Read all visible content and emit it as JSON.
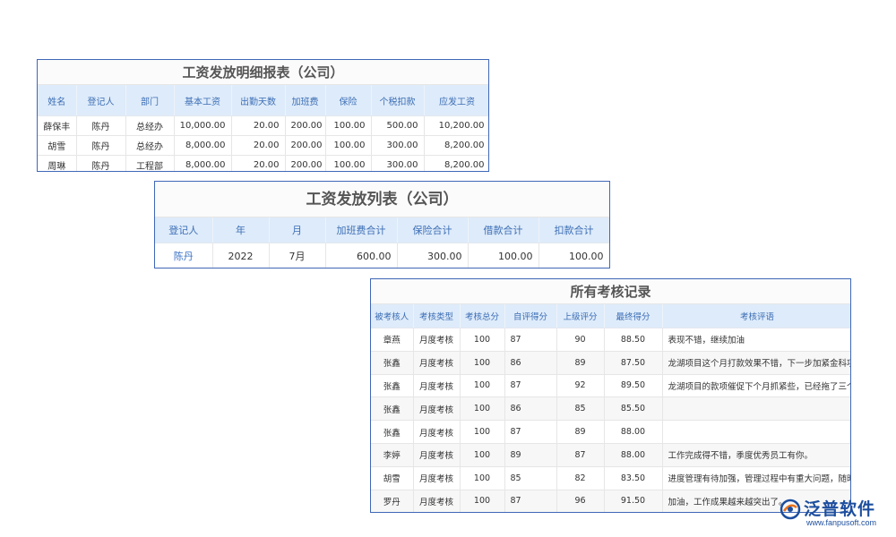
{
  "salary_detail": {
    "title": "工资发放明细报表（公司）",
    "columns": [
      "姓名",
      "登记人",
      "部门",
      "基本工资",
      "出勤天数",
      "加班费",
      "保险",
      "个税扣款",
      "应发工资"
    ],
    "rows": [
      [
        "薛保丰",
        "陈丹",
        "总经办",
        "10,000.00",
        "20.00",
        "200.00",
        "100.00",
        "500.00",
        "10,200.00"
      ],
      [
        "胡雪",
        "陈丹",
        "总经办",
        "8,000.00",
        "20.00",
        "200.00",
        "100.00",
        "300.00",
        "8,200.00"
      ],
      [
        "周琳",
        "陈丹",
        "工程部",
        "8,000.00",
        "20.00",
        "200.00",
        "100.00",
        "300.00",
        "8,200.00"
      ]
    ]
  },
  "salary_list": {
    "title": "工资发放列表（公司）",
    "columns": [
      "登记人",
      "年",
      "月",
      "加班费合计",
      "保险合计",
      "借款合计",
      "扣款合计"
    ],
    "rows": [
      [
        "陈丹",
        "2022",
        "7月",
        "600.00",
        "300.00",
        "100.00",
        "100.00"
      ]
    ]
  },
  "assessment": {
    "title": "所有考核记录",
    "columns": [
      "被考核人",
      "考核类型",
      "考核总分",
      "自评得分",
      "上级评分",
      "最终得分",
      "考核评语"
    ],
    "rows": [
      [
        "章燕",
        "月度考核",
        "100",
        "87",
        "90",
        "88.50",
        "表现不错，继续加油"
      ],
      [
        "张鑫",
        "月度考核",
        "100",
        "86",
        "89",
        "87.50",
        "龙湖项目这个月打款效果不错，下一步加紧金科项目"
      ],
      [
        "张鑫",
        "月度考核",
        "100",
        "87",
        "92",
        "89.50",
        "龙湖项目的款项催促下个月抓紧些，已经拖了三个月"
      ],
      [
        "张鑫",
        "月度考核",
        "100",
        "86",
        "85",
        "85.50",
        ""
      ],
      [
        "张鑫",
        "月度考核",
        "100",
        "87",
        "89",
        "88.00",
        ""
      ],
      [
        "李婷",
        "月度考核",
        "100",
        "89",
        "87",
        "88.00",
        "工作完成得不错，季度优秀员工有你。"
      ],
      [
        "胡雪",
        "月度考核",
        "100",
        "85",
        "82",
        "83.50",
        "进度管理有待加强，管理过程中有重大问题，随时汇报"
      ],
      [
        "罗丹",
        "月度考核",
        "100",
        "87",
        "96",
        "91.50",
        "加油，工作成果越来越突出了。"
      ]
    ]
  },
  "logo": {
    "brand": "泛普软件",
    "url": "www.fanpusoft.com",
    "color": "#1d4e9e"
  }
}
